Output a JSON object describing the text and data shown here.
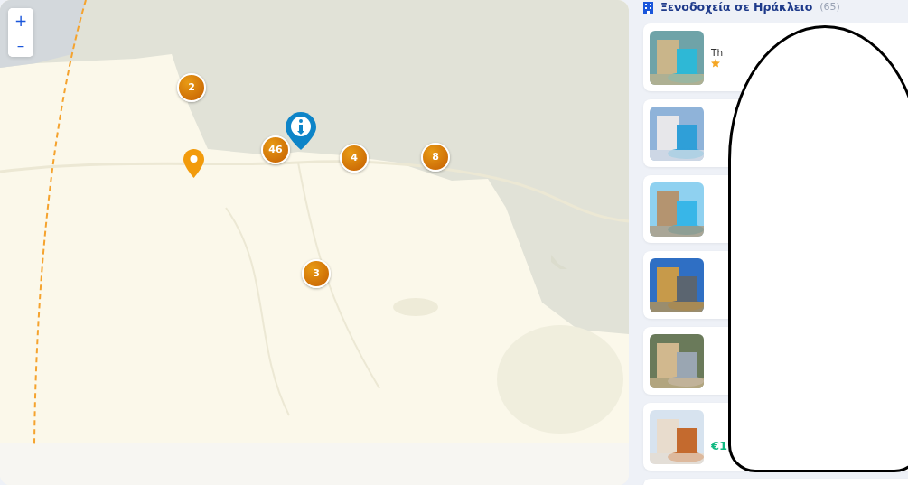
{
  "map": {
    "zoom_controls": [
      "+",
      "–"
    ],
    "clusters": [
      {
        "count": "2"
      },
      {
        "count": "46"
      },
      {
        "count": "4"
      },
      {
        "count": "8"
      },
      {
        "count": "3"
      }
    ]
  },
  "list": {
    "title": "Ξενοδοχεία σε Ηράκλειο",
    "count": "(65)",
    "hotels": [
      {
        "kind": "rated-card",
        "name": "Th"
      },
      {
        "kind": "photo-card"
      },
      {
        "kind": "photo-card"
      },
      {
        "kind": "photo-card"
      },
      {
        "kind": "photo-card"
      },
      {
        "kind": "photo-card",
        "price": "€1"
      }
    ]
  }
}
